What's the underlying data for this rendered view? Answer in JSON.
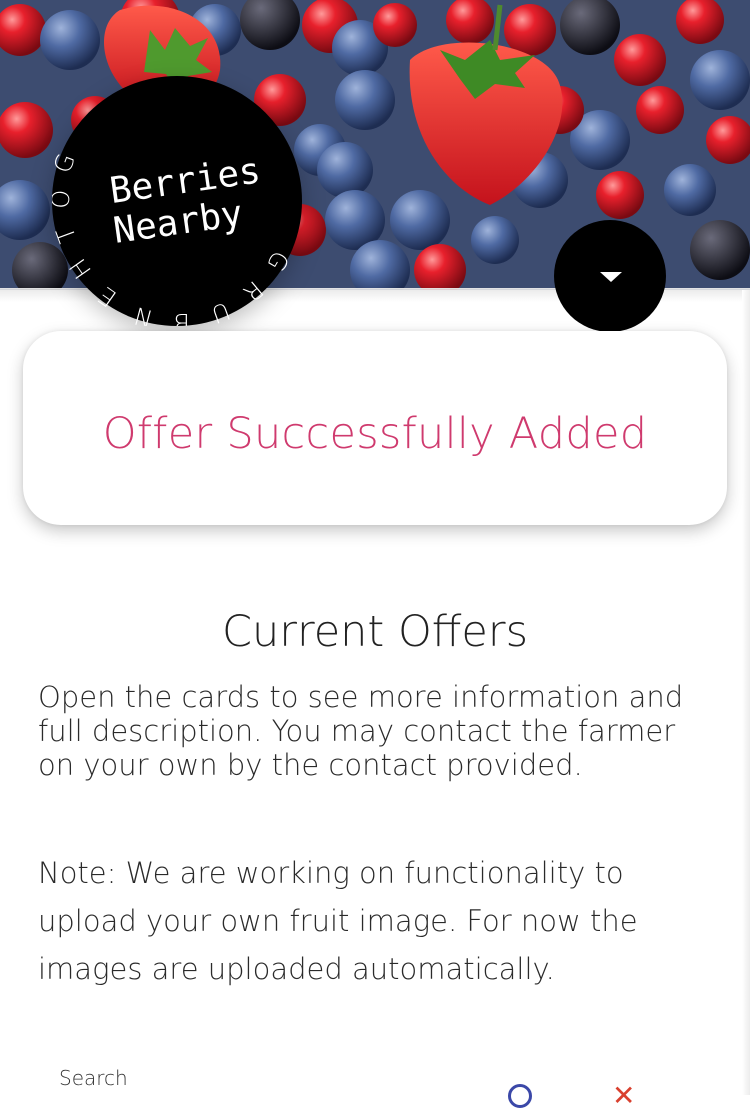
{
  "brand": {
    "logo_line1": "Berries",
    "logo_line2": "Nearby",
    "logo_ring_text": "GOTHENBURG"
  },
  "header": {
    "menu_icon": "caret-down-icon"
  },
  "alert": {
    "message": "Offer Successfully Added"
  },
  "main": {
    "title": "Current Offers",
    "intro": "Open the cards to see more information and full description. You may contact the farmer on your own by the contact provided.",
    "note": "Note: We are working on functionality to upload your own fruit image. For now the images are uploaded automatically."
  },
  "search": {
    "label": "Search",
    "search_icon": "search-icon",
    "clear_icon": "close-icon"
  },
  "colors": {
    "alert_text": "#cf3a6e",
    "logo_bg": "#000000",
    "search_icon": "#3b48a8",
    "clear_icon": "#d9402e"
  }
}
